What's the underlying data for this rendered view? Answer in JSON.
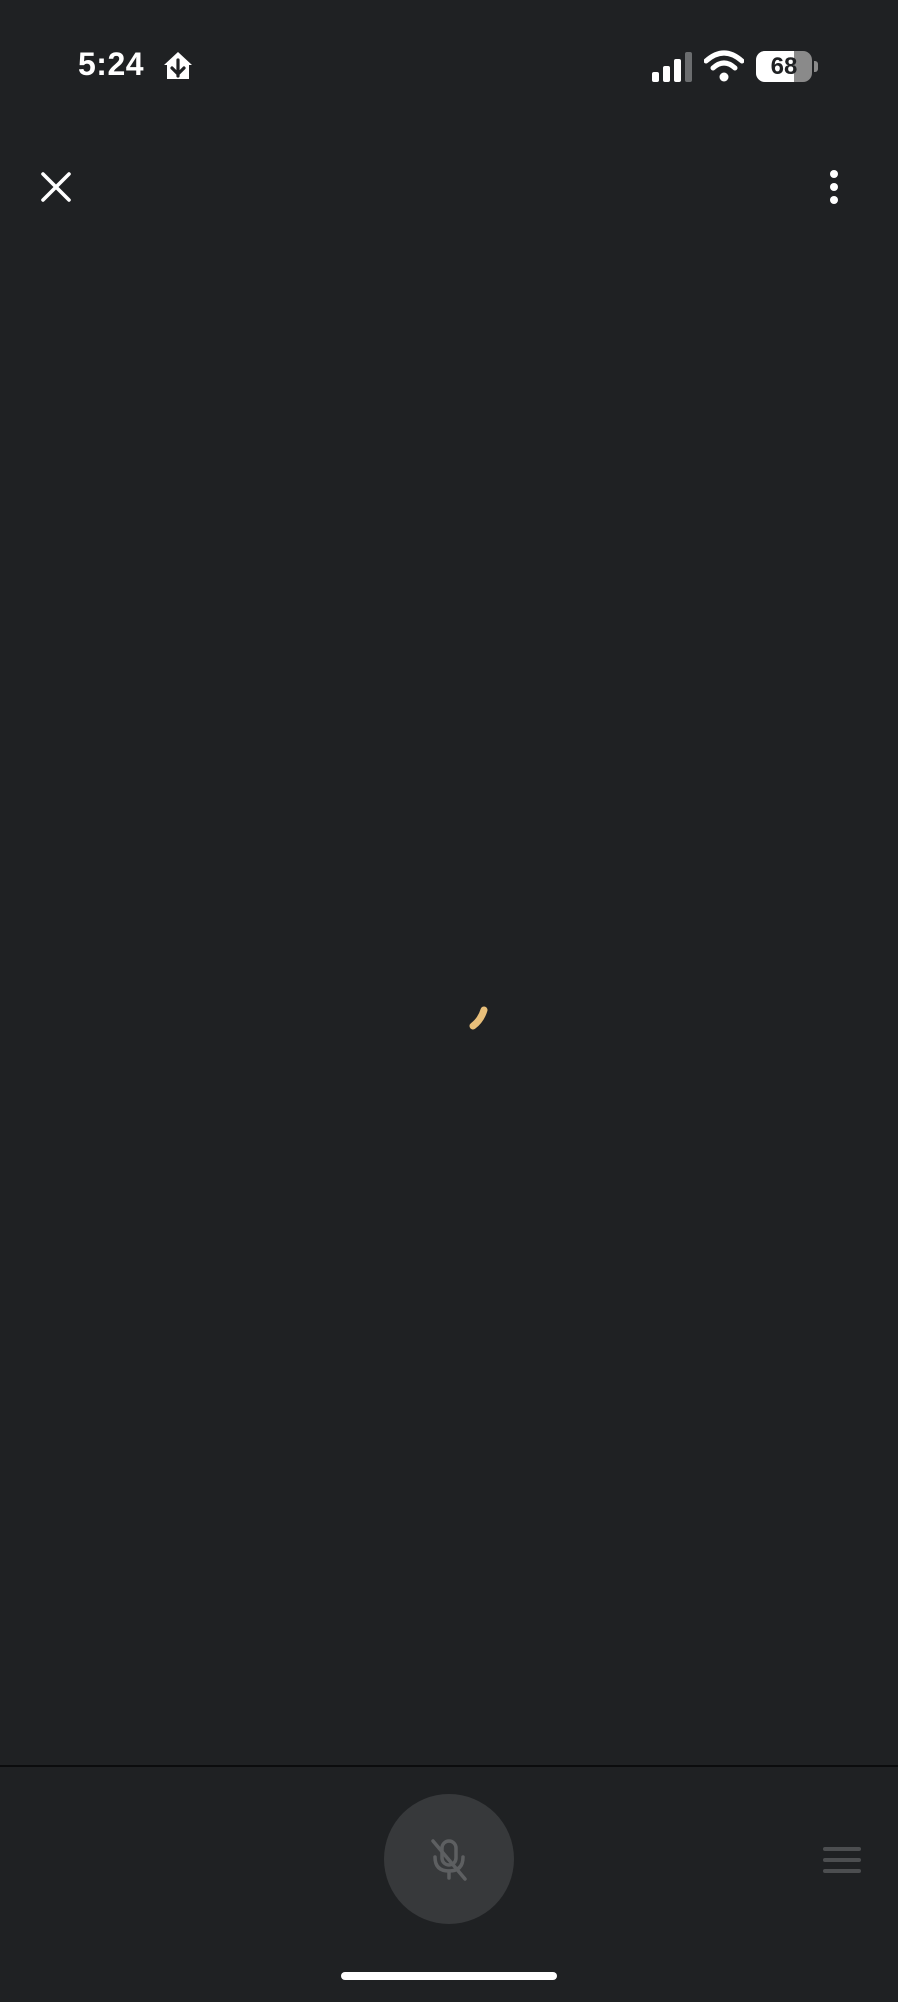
{
  "status_bar": {
    "time": "5:24",
    "battery_percent": 68,
    "battery_label": "68",
    "icons": [
      "home-app-icon",
      "cellular-signal-icon",
      "wifi-icon",
      "battery-icon"
    ]
  },
  "top_bar": {
    "icons": [
      "close-icon",
      "more-vertical-icon"
    ]
  },
  "content": {
    "loading_indicator": "spinner-icon"
  },
  "bottom_bar": {
    "icons": [
      "mic-off-icon",
      "menu-icon"
    ]
  },
  "colors": {
    "background": "#1f2123",
    "spinner_accent": "#e8bf7a",
    "mic_button_bg": "#37393b",
    "disabled_icon": "#5d5f61"
  }
}
